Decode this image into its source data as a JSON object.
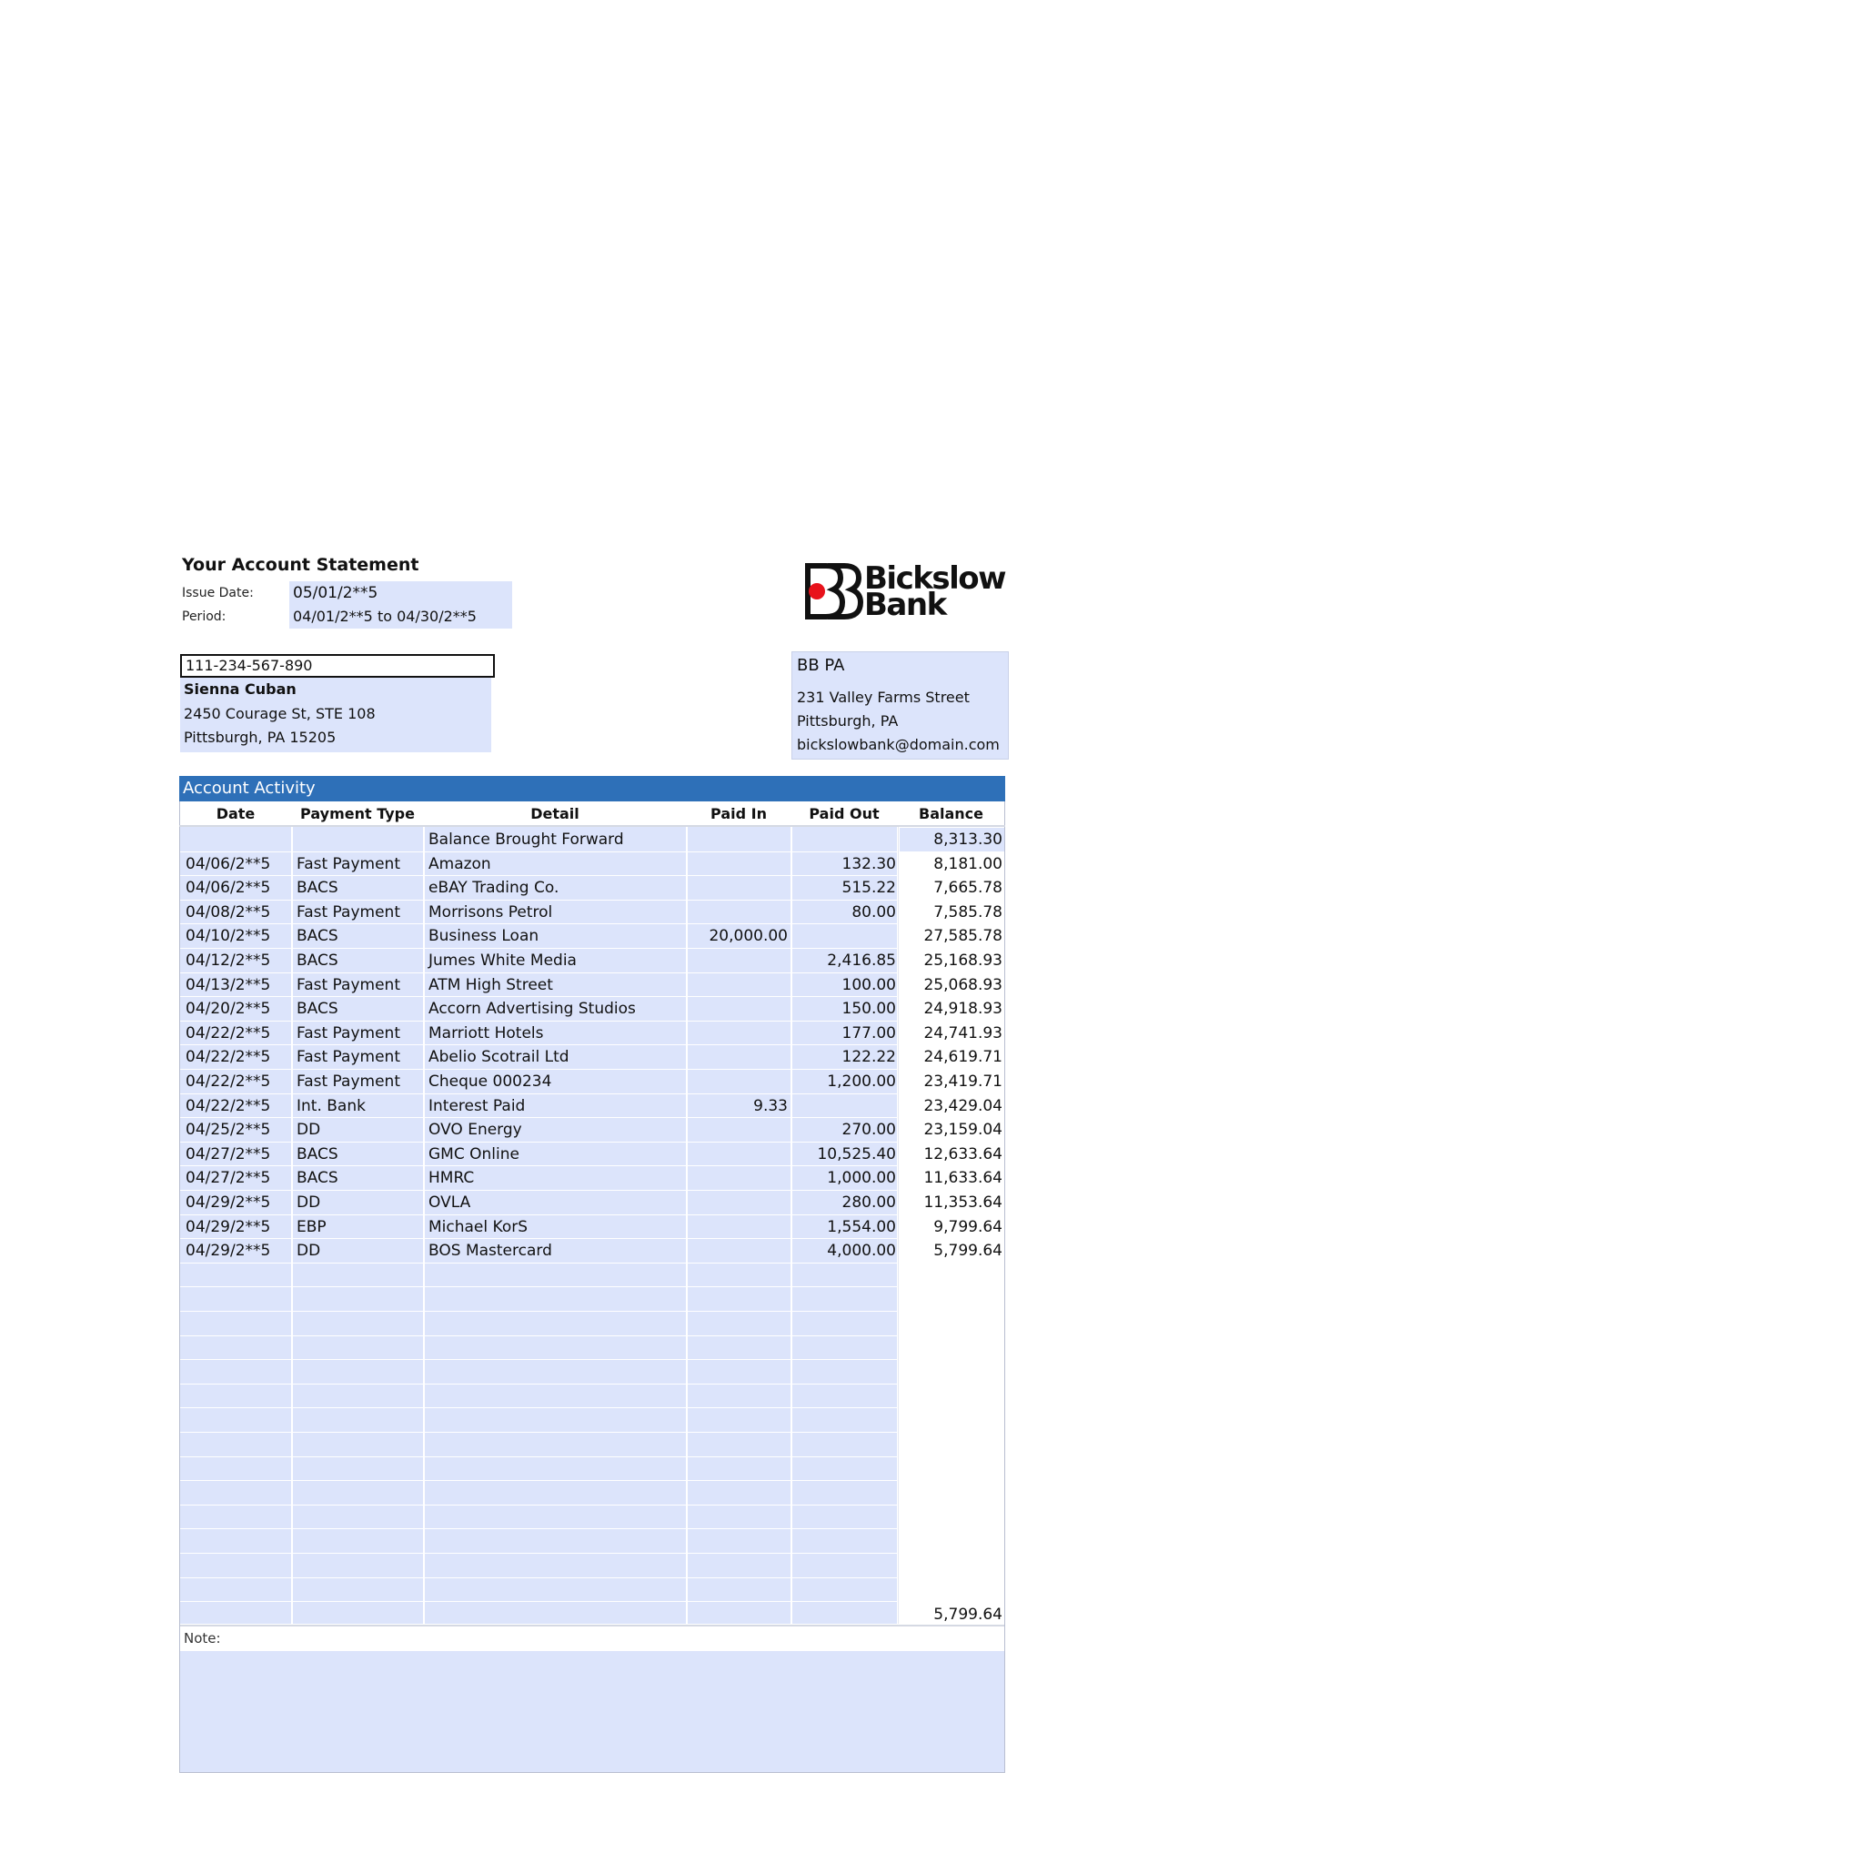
{
  "statement": {
    "title": "Your Account Statement",
    "issue_date_label": "Issue Date:",
    "issue_date": "05/01/2**5",
    "period_label": "Period:",
    "period": "04/01/2**5 to 04/30/2**5"
  },
  "bank": {
    "logo_line1": "Bickslow",
    "logo_line2": "Bank",
    "branch": "BB PA",
    "address1": "231 Valley Farms Street",
    "address2": "Pittsburgh, PA",
    "email": "bickslowbank@domain.com"
  },
  "customer": {
    "account_number": "111-234-567-890",
    "name": "Sienna Cuban",
    "address1": "2450 Courage St, STE 108",
    "address2": "Pittsburgh, PA 15205"
  },
  "activity": {
    "title": "Account Activity",
    "columns": [
      "Date",
      "Payment Type",
      "Detail",
      "Paid In",
      "Paid Out",
      "Balance"
    ],
    "rows": [
      {
        "date": "",
        "type": "",
        "detail": "Balance Brought Forward",
        "paid_in": "",
        "paid_out": "",
        "balance": "8,313.30"
      },
      {
        "date": "04/06/2**5",
        "type": "Fast Payment",
        "detail": "Amazon",
        "paid_in": "",
        "paid_out": "132.30",
        "balance": "8,181.00"
      },
      {
        "date": "04/06/2**5",
        "type": "BACS",
        "detail": "eBAY Trading Co.",
        "paid_in": "",
        "paid_out": "515.22",
        "balance": "7,665.78"
      },
      {
        "date": "04/08/2**5",
        "type": "Fast Payment",
        "detail": "Morrisons Petrol",
        "paid_in": "",
        "paid_out": "80.00",
        "balance": "7,585.78"
      },
      {
        "date": "04/10/2**5",
        "type": "BACS",
        "detail": "Business Loan",
        "paid_in": "20,000.00",
        "paid_out": "",
        "balance": "27,585.78"
      },
      {
        "date": "04/12/2**5",
        "type": "BACS",
        "detail": "Jumes White Media",
        "paid_in": "",
        "paid_out": "2,416.85",
        "balance": "25,168.93"
      },
      {
        "date": "04/13/2**5",
        "type": "Fast Payment",
        "detail": "ATM High Street",
        "paid_in": "",
        "paid_out": "100.00",
        "balance": "25,068.93"
      },
      {
        "date": "04/20/2**5",
        "type": "BACS",
        "detail": "Accorn Advertising Studios",
        "paid_in": "",
        "paid_out": "150.00",
        "balance": "24,918.93"
      },
      {
        "date": "04/22/2**5",
        "type": "Fast Payment",
        "detail": "Marriott Hotels",
        "paid_in": "",
        "paid_out": "177.00",
        "balance": "24,741.93"
      },
      {
        "date": "04/22/2**5",
        "type": "Fast Payment",
        "detail": "Abelio Scotrail Ltd",
        "paid_in": "",
        "paid_out": "122.22",
        "balance": "24,619.71"
      },
      {
        "date": "04/22/2**5",
        "type": "Fast Payment",
        "detail": "Cheque 000234",
        "paid_in": "",
        "paid_out": "1,200.00",
        "balance": "23,419.71"
      },
      {
        "date": "04/22/2**5",
        "type": "Int. Bank",
        "detail": "Interest Paid",
        "paid_in": "9.33",
        "paid_out": "",
        "balance": "23,429.04"
      },
      {
        "date": "04/25/2**5",
        "type": "DD",
        "detail": "OVO Energy",
        "paid_in": "",
        "paid_out": "270.00",
        "balance": "23,159.04"
      },
      {
        "date": "04/27/2**5",
        "type": "BACS",
        "detail": "GMC Online",
        "paid_in": "",
        "paid_out": "10,525.40",
        "balance": "12,633.64"
      },
      {
        "date": "04/27/2**5",
        "type": "BACS",
        "detail": "HMRC",
        "paid_in": "",
        "paid_out": "1,000.00",
        "balance": "11,633.64"
      },
      {
        "date": "04/29/2**5",
        "type": "DD",
        "detail": "OVLA",
        "paid_in": "",
        "paid_out": "280.00",
        "balance": "11,353.64"
      },
      {
        "date": "04/29/2**5",
        "type": "EBP",
        "detail": "Michael KorS",
        "paid_in": "",
        "paid_out": "1,554.00",
        "balance": "9,799.64"
      },
      {
        "date": "04/29/2**5",
        "type": "DD",
        "detail": "BOS Mastercard",
        "paid_in": "",
        "paid_out": "4,000.00",
        "balance": "5,799.64"
      }
    ],
    "closing_balance": "5,799.64",
    "note_label": "Note:",
    "note": ""
  },
  "colors": {
    "header_bar": "#2e70b8",
    "field_fill": "#dce4fb",
    "logo_dot": "#e8121b"
  }
}
